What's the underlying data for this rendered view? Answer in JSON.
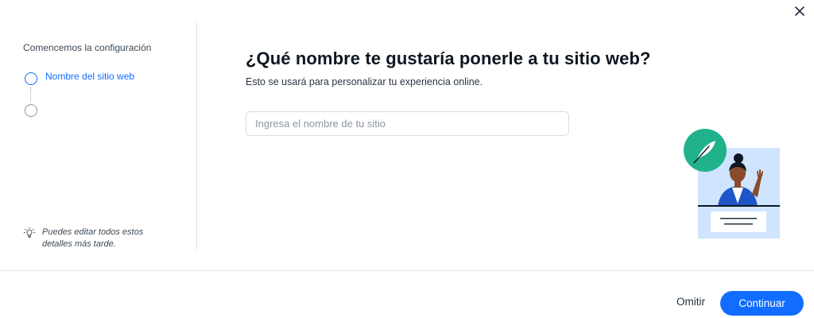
{
  "sidebar": {
    "title": "Comencemos la configuración",
    "steps": [
      {
        "label": "Nombre del sitio web",
        "active": true
      },
      {
        "label": "",
        "active": false
      }
    ],
    "tip": "Puedes editar todos estos detalles más tarde.",
    "tip_icon": "lightbulb-icon"
  },
  "main": {
    "title": "¿Qué nombre te gustaría ponerle a tu sitio web?",
    "subtitle": "Esto se usará para personalizar tu experiencia online.",
    "input": {
      "placeholder": "Ingresa el nombre de tu sitio",
      "value": ""
    }
  },
  "footer": {
    "skip_label": "Omitir",
    "continue_label": "Continuar"
  },
  "icons": {
    "close": "close-icon",
    "illustration": "person-with-feather-illustration"
  },
  "colors": {
    "accent": "#116dff",
    "badge": "#21b28c",
    "illustration_bg": "#cfe4ff"
  }
}
